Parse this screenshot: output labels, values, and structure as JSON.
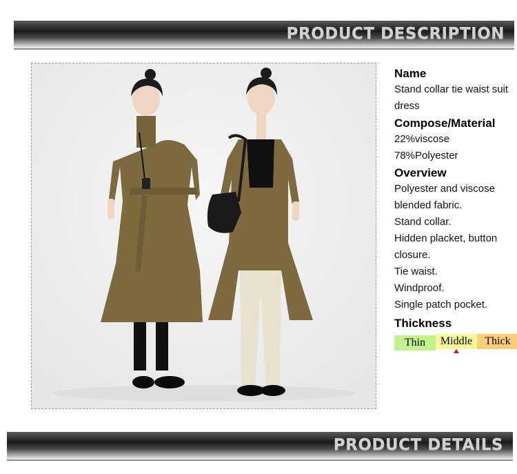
{
  "banners": {
    "top": "PRODUCT DESCRIPTION",
    "bottom": "PRODUCT DETAILS"
  },
  "description": {
    "name_heading": "Name",
    "name_lines": [
      "Stand collar tie waist suit",
      "dress"
    ],
    "material_heading": "Compose/Material",
    "material_lines": [
      "22%viscose",
      "78%Polyester"
    ],
    "overview_heading": "Overview",
    "overview_lines": [
      "Polyester and viscose",
      "blended fabric.",
      "Stand collar.",
      "Hidden placket, button",
      "closure.",
      "Tie waist.",
      "Windproof.",
      "Single patch pocket."
    ],
    "thickness_heading": "Thickness",
    "thickness_options": [
      "Thin",
      "Middle",
      "Thick"
    ],
    "thickness_selected": "Middle"
  },
  "colors": {
    "thin": "#c2f28c",
    "middle": "#f7f79a",
    "thick": "#fbcd78",
    "marker": "#b81818",
    "coat": "#7d6a3f",
    "trousers": "#e9e1cf"
  }
}
